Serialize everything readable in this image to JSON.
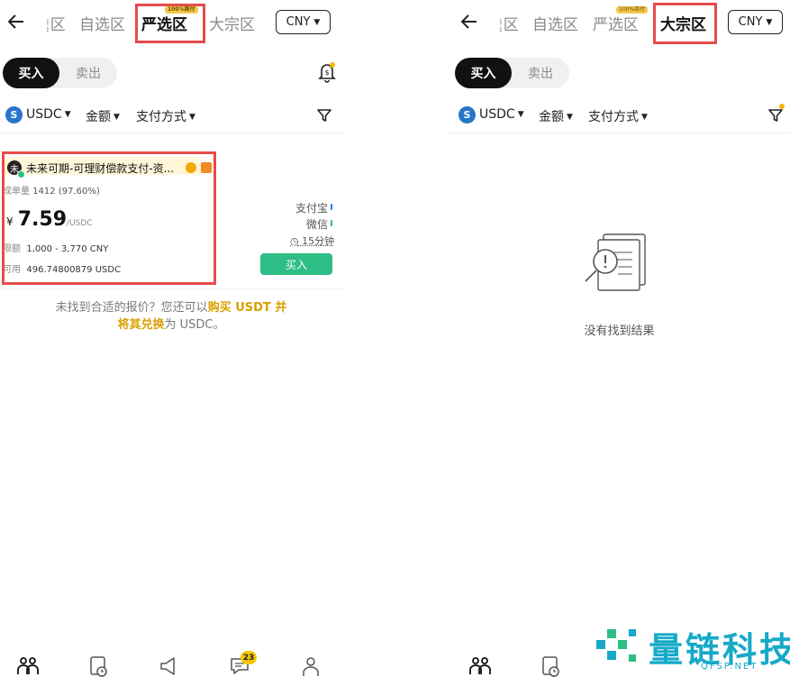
{
  "left": {
    "tabs": [
      {
        "label": "区"
      },
      {
        "label": "自选区"
      },
      {
        "label": "严选区",
        "active": true,
        "badge": "100%商付"
      },
      {
        "label": "大宗区"
      }
    ],
    "currency": "CNY",
    "segment": {
      "buy": "买入",
      "sell": "卖出"
    },
    "filters": {
      "coin_icon": "S",
      "coin": "USDC",
      "amount": "金额",
      "payment": "支付方式"
    },
    "offer": {
      "avatar": "未",
      "merchant": "未来可期-可理财偿款支付-资...",
      "stats_label": "成单量",
      "stats_value": "1412 (97.60%)",
      "currency_symbol": "¥",
      "price": "7.59",
      "unit": "/USDC",
      "limit_label": "限额",
      "limit_value": "1,000 - 3,770 CNY",
      "avail_label": "可用",
      "avail_value": "496.74800879 USDC",
      "payments": [
        {
          "name": "支付宝",
          "color": "#1677ff"
        },
        {
          "name": "微信",
          "color": "#2ebd85"
        }
      ],
      "time": "15分钟",
      "action": "买入"
    },
    "notice": {
      "p1": "未找到合适的报价？您还可以",
      "l1": "购买 USDT 并",
      "l2": "将其兑换",
      "p2": "为 USDC。"
    },
    "nav": {
      "chat_badge": "23"
    }
  },
  "right": {
    "tabs": [
      {
        "label": "区"
      },
      {
        "label": "自选区"
      },
      {
        "label": "严选区",
        "badge": "100%商付"
      },
      {
        "label": "大宗区",
        "active": true
      }
    ],
    "currency": "CNY",
    "segment": {
      "buy": "买入",
      "sell": "卖出"
    },
    "filters": {
      "coin_icon": "S",
      "coin": "USDC",
      "amount": "金额",
      "payment": "支付方式"
    },
    "empty": "没有找到结果"
  },
  "watermark": {
    "text": "量链科技",
    "sub": "QFSP.NET"
  },
  "colors": {
    "accent": "#2ebd85",
    "highlight": "#e74c4c",
    "gold": "#d9a000",
    "badge": "#f7c600"
  }
}
